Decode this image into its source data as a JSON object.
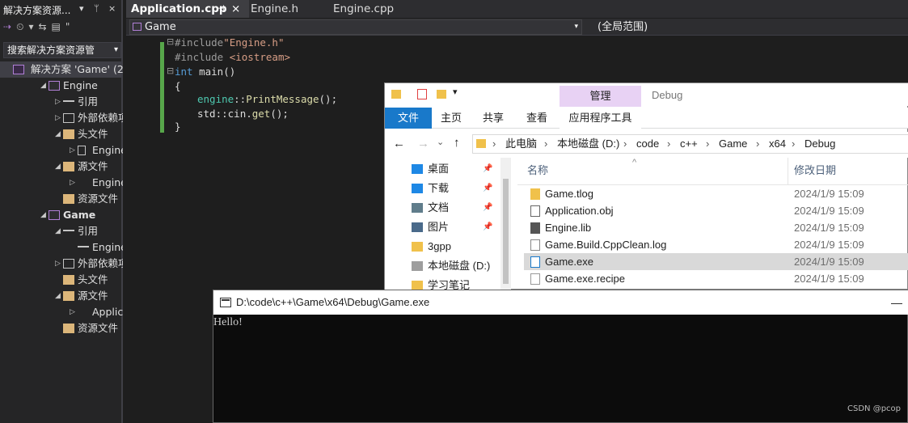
{
  "solution_explorer": {
    "title": "解决方案资源...",
    "title_controls": [
      "▾",
      "ᛘ",
      "×"
    ],
    "toolbar": [
      "⇢",
      "⏲",
      "▾",
      "⇆",
      "▤",
      "\""
    ],
    "search_placeholder": "搜索解决方案资源管",
    "tree": [
      {
        "label": "解决方案 'Game' (2",
        "icon": "solution-icon",
        "level": 0,
        "expander": "",
        "bold": false
      },
      {
        "label": "Engine",
        "icon": "project-icon",
        "level": 1,
        "expander": "◢",
        "bold": false
      },
      {
        "label": "引用",
        "icon": "references-icon",
        "level": 2,
        "expander": "▷",
        "bold": false
      },
      {
        "label": "外部依赖项",
        "icon": "external-deps-icon",
        "level": 2,
        "expander": "▷",
        "bold": false
      },
      {
        "label": "头文件",
        "icon": "folder-icon",
        "level": 2,
        "expander": "◢",
        "bold": false
      },
      {
        "label": "Engine.h",
        "icon": "header-file-icon",
        "level": 3,
        "expander": "▷",
        "bold": false
      },
      {
        "label": "源文件",
        "icon": "folder-icon",
        "level": 2,
        "expander": "◢",
        "bold": false
      },
      {
        "label": "Engine.cp",
        "icon": "cpp-file-icon",
        "level": 3,
        "expander": "▷",
        "bold": false
      },
      {
        "label": "资源文件",
        "icon": "folder-icon",
        "level": 2,
        "expander": "",
        "bold": false
      },
      {
        "label": "Game",
        "icon": "project-icon",
        "level": 1,
        "expander": "◢",
        "bold": true
      },
      {
        "label": "引用",
        "icon": "references-icon",
        "level": 2,
        "expander": "◢",
        "bold": false
      },
      {
        "label": "Engine",
        "icon": "references-icon",
        "level": 3,
        "expander": "",
        "bold": false
      },
      {
        "label": "外部依赖项",
        "icon": "external-deps-icon",
        "level": 2,
        "expander": "▷",
        "bold": false
      },
      {
        "label": "头文件",
        "icon": "folder-icon",
        "level": 2,
        "expander": "",
        "bold": false
      },
      {
        "label": "源文件",
        "icon": "folder-icon",
        "level": 2,
        "expander": "◢",
        "bold": false
      },
      {
        "label": "Applicatio",
        "icon": "cpp-file-icon",
        "level": 3,
        "expander": "▷",
        "bold": false
      },
      {
        "label": "资源文件",
        "icon": "folder-icon",
        "level": 2,
        "expander": "",
        "bold": false
      }
    ]
  },
  "editor_tabs": {
    "active": "Application.cpp",
    "pin": "⊣",
    "close": "×",
    "others": [
      "Engine.h",
      "Engine.cpp"
    ]
  },
  "nav_bar": {
    "project": "Game",
    "scope": "(全局范围)"
  },
  "code": {
    "line1_prefix": "#include",
    "line1_str": "\"Engine.h\"",
    "line2_prefix": "#include ",
    "line2_str": "<iostream>",
    "line3_kw": "int",
    "line3_rest": " main()",
    "line4": "{",
    "line5_ns": "engine",
    "line5_sep": "::",
    "line5_fn": "PrintMessage",
    "line5_rest": "();",
    "line6_ns": "std",
    "line6_sep": "::",
    "line6_obj": "cin",
    "line6_dot": ".",
    "line6_fn": "get",
    "line6_rest": "();",
    "line7": "}",
    "fold_markers": [
      "⊟",
      "⊟"
    ]
  },
  "explorer": {
    "quick_access_icons": [
      "folder-icon",
      "checklist-icon",
      "folder-icon",
      "dropdown-icon"
    ],
    "ribbon_context": "管理",
    "window_title": "Debug",
    "ribbon_tabs": [
      "文件",
      "主页",
      "共享",
      "查看",
      "应用程序工具"
    ],
    "nav_buttons": [
      "←",
      "→",
      "⌄",
      "↑"
    ],
    "breadcrumb": [
      "此电脑",
      "本地磁盘 (D:)",
      "code",
      "c++",
      "Game",
      "x64",
      "Debug"
    ],
    "breadcrumb_sep": "›",
    "nav_pane": [
      {
        "label": "桌面",
        "icon": "desktop-icon",
        "pinned": true
      },
      {
        "label": "下载",
        "icon": "download-icon",
        "pinned": true
      },
      {
        "label": "文档",
        "icon": "document-icon",
        "pinned": true
      },
      {
        "label": "图片",
        "icon": "picture-icon",
        "pinned": true
      },
      {
        "label": "3gpp",
        "icon": "folder-icon",
        "pinned": false
      },
      {
        "label": "本地磁盘 (D:)",
        "icon": "drive-icon",
        "pinned": false
      },
      {
        "label": "学习笔记",
        "icon": "folder-icon",
        "pinned": false
      }
    ],
    "pin_glyph": "📌",
    "columns": {
      "name": "名称",
      "modified": "修改日期",
      "sort_glyph": "^"
    },
    "files": [
      {
        "name": "Game.tlog",
        "date": "2024/1/9 15:09",
        "icon": "folder-icon",
        "selected": false
      },
      {
        "name": "Application.obj",
        "date": "2024/1/9 15:09",
        "icon": "obj-file-icon",
        "selected": false
      },
      {
        "name": "Engine.lib",
        "date": "2024/1/9 15:09",
        "icon": "lib-file-icon",
        "selected": false
      },
      {
        "name": "Game.Build.CppClean.log",
        "date": "2024/1/9 15:09",
        "icon": "text-file-icon",
        "selected": false
      },
      {
        "name": "Game.exe",
        "date": "2024/1/9 15:09",
        "icon": "exe-file-icon",
        "selected": true
      },
      {
        "name": "Game.exe.recipe",
        "date": "2024/1/9 15:09",
        "icon": "file-icon",
        "selected": false
      }
    ]
  },
  "console": {
    "title": "D:\\code\\c++\\Game\\x64\\Debug\\Game.exe",
    "minimize": "—",
    "output": "Hello!"
  },
  "watermark": "CSDN @pcop",
  "colors": {
    "accent": "#1979ca",
    "manage": "#e8d2f4",
    "gutter": "#57a64a"
  }
}
